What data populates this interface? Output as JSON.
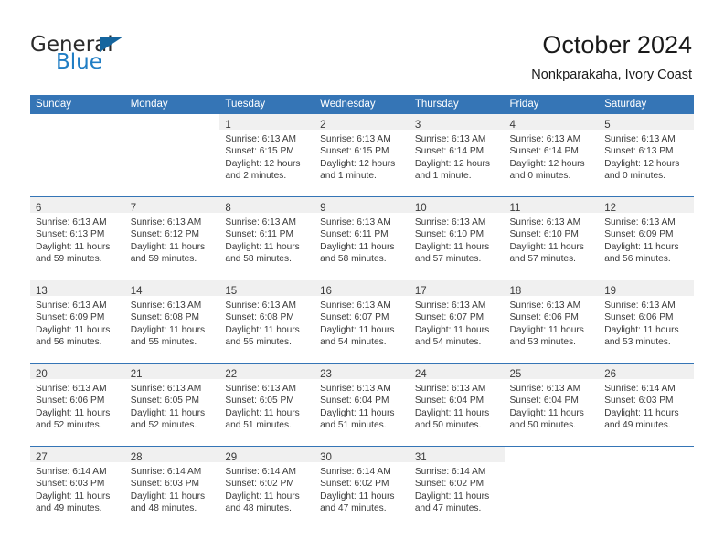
{
  "brand": {
    "name_top": "General",
    "name_bottom": "Blue",
    "triangle_color": "#15659e",
    "blue_color": "#1f7dc4"
  },
  "header": {
    "title": "October 2024",
    "subtitle": "Nonkparakaha, Ivory Coast"
  },
  "theme": {
    "header_band": "#3575b6",
    "daynum_band": "#f0f0f0",
    "row_divider": "#3575b6",
    "text": "#3a3a3a"
  },
  "weekdays": [
    "Sunday",
    "Monday",
    "Tuesday",
    "Wednesday",
    "Thursday",
    "Friday",
    "Saturday"
  ],
  "labels": {
    "sunrise_prefix": "Sunrise:",
    "sunset_prefix": "Sunset:",
    "daylight_prefix": "Daylight:"
  },
  "weeks": [
    [
      {
        "day": "",
        "lines": []
      },
      {
        "day": "",
        "lines": []
      },
      {
        "day": "1",
        "lines": [
          "Sunrise: 6:13 AM",
          "Sunset: 6:15 PM",
          "Daylight: 12 hours",
          "and 2 minutes."
        ]
      },
      {
        "day": "2",
        "lines": [
          "Sunrise: 6:13 AM",
          "Sunset: 6:15 PM",
          "Daylight: 12 hours",
          "and 1 minute."
        ]
      },
      {
        "day": "3",
        "lines": [
          "Sunrise: 6:13 AM",
          "Sunset: 6:14 PM",
          "Daylight: 12 hours",
          "and 1 minute."
        ]
      },
      {
        "day": "4",
        "lines": [
          "Sunrise: 6:13 AM",
          "Sunset: 6:14 PM",
          "Daylight: 12 hours",
          "and 0 minutes."
        ]
      },
      {
        "day": "5",
        "lines": [
          "Sunrise: 6:13 AM",
          "Sunset: 6:13 PM",
          "Daylight: 12 hours",
          "and 0 minutes."
        ]
      }
    ],
    [
      {
        "day": "6",
        "lines": [
          "Sunrise: 6:13 AM",
          "Sunset: 6:13 PM",
          "Daylight: 11 hours",
          "and 59 minutes."
        ]
      },
      {
        "day": "7",
        "lines": [
          "Sunrise: 6:13 AM",
          "Sunset: 6:12 PM",
          "Daylight: 11 hours",
          "and 59 minutes."
        ]
      },
      {
        "day": "8",
        "lines": [
          "Sunrise: 6:13 AM",
          "Sunset: 6:11 PM",
          "Daylight: 11 hours",
          "and 58 minutes."
        ]
      },
      {
        "day": "9",
        "lines": [
          "Sunrise: 6:13 AM",
          "Sunset: 6:11 PM",
          "Daylight: 11 hours",
          "and 58 minutes."
        ]
      },
      {
        "day": "10",
        "lines": [
          "Sunrise: 6:13 AM",
          "Sunset: 6:10 PM",
          "Daylight: 11 hours",
          "and 57 minutes."
        ]
      },
      {
        "day": "11",
        "lines": [
          "Sunrise: 6:13 AM",
          "Sunset: 6:10 PM",
          "Daylight: 11 hours",
          "and 57 minutes."
        ]
      },
      {
        "day": "12",
        "lines": [
          "Sunrise: 6:13 AM",
          "Sunset: 6:09 PM",
          "Daylight: 11 hours",
          "and 56 minutes."
        ]
      }
    ],
    [
      {
        "day": "13",
        "lines": [
          "Sunrise: 6:13 AM",
          "Sunset: 6:09 PM",
          "Daylight: 11 hours",
          "and 56 minutes."
        ]
      },
      {
        "day": "14",
        "lines": [
          "Sunrise: 6:13 AM",
          "Sunset: 6:08 PM",
          "Daylight: 11 hours",
          "and 55 minutes."
        ]
      },
      {
        "day": "15",
        "lines": [
          "Sunrise: 6:13 AM",
          "Sunset: 6:08 PM",
          "Daylight: 11 hours",
          "and 55 minutes."
        ]
      },
      {
        "day": "16",
        "lines": [
          "Sunrise: 6:13 AM",
          "Sunset: 6:07 PM",
          "Daylight: 11 hours",
          "and 54 minutes."
        ]
      },
      {
        "day": "17",
        "lines": [
          "Sunrise: 6:13 AM",
          "Sunset: 6:07 PM",
          "Daylight: 11 hours",
          "and 54 minutes."
        ]
      },
      {
        "day": "18",
        "lines": [
          "Sunrise: 6:13 AM",
          "Sunset: 6:06 PM",
          "Daylight: 11 hours",
          "and 53 minutes."
        ]
      },
      {
        "day": "19",
        "lines": [
          "Sunrise: 6:13 AM",
          "Sunset: 6:06 PM",
          "Daylight: 11 hours",
          "and 53 minutes."
        ]
      }
    ],
    [
      {
        "day": "20",
        "lines": [
          "Sunrise: 6:13 AM",
          "Sunset: 6:06 PM",
          "Daylight: 11 hours",
          "and 52 minutes."
        ]
      },
      {
        "day": "21",
        "lines": [
          "Sunrise: 6:13 AM",
          "Sunset: 6:05 PM",
          "Daylight: 11 hours",
          "and 52 minutes."
        ]
      },
      {
        "day": "22",
        "lines": [
          "Sunrise: 6:13 AM",
          "Sunset: 6:05 PM",
          "Daylight: 11 hours",
          "and 51 minutes."
        ]
      },
      {
        "day": "23",
        "lines": [
          "Sunrise: 6:13 AM",
          "Sunset: 6:04 PM",
          "Daylight: 11 hours",
          "and 51 minutes."
        ]
      },
      {
        "day": "24",
        "lines": [
          "Sunrise: 6:13 AM",
          "Sunset: 6:04 PM",
          "Daylight: 11 hours",
          "and 50 minutes."
        ]
      },
      {
        "day": "25",
        "lines": [
          "Sunrise: 6:13 AM",
          "Sunset: 6:04 PM",
          "Daylight: 11 hours",
          "and 50 minutes."
        ]
      },
      {
        "day": "26",
        "lines": [
          "Sunrise: 6:14 AM",
          "Sunset: 6:03 PM",
          "Daylight: 11 hours",
          "and 49 minutes."
        ]
      }
    ],
    [
      {
        "day": "27",
        "lines": [
          "Sunrise: 6:14 AM",
          "Sunset: 6:03 PM",
          "Daylight: 11 hours",
          "and 49 minutes."
        ]
      },
      {
        "day": "28",
        "lines": [
          "Sunrise: 6:14 AM",
          "Sunset: 6:03 PM",
          "Daylight: 11 hours",
          "and 48 minutes."
        ]
      },
      {
        "day": "29",
        "lines": [
          "Sunrise: 6:14 AM",
          "Sunset: 6:02 PM",
          "Daylight: 11 hours",
          "and 48 minutes."
        ]
      },
      {
        "day": "30",
        "lines": [
          "Sunrise: 6:14 AM",
          "Sunset: 6:02 PM",
          "Daylight: 11 hours",
          "and 47 minutes."
        ]
      },
      {
        "day": "31",
        "lines": [
          "Sunrise: 6:14 AM",
          "Sunset: 6:02 PM",
          "Daylight: 11 hours",
          "and 47 minutes."
        ]
      },
      {
        "day": "",
        "lines": []
      },
      {
        "day": "",
        "lines": []
      }
    ]
  ]
}
